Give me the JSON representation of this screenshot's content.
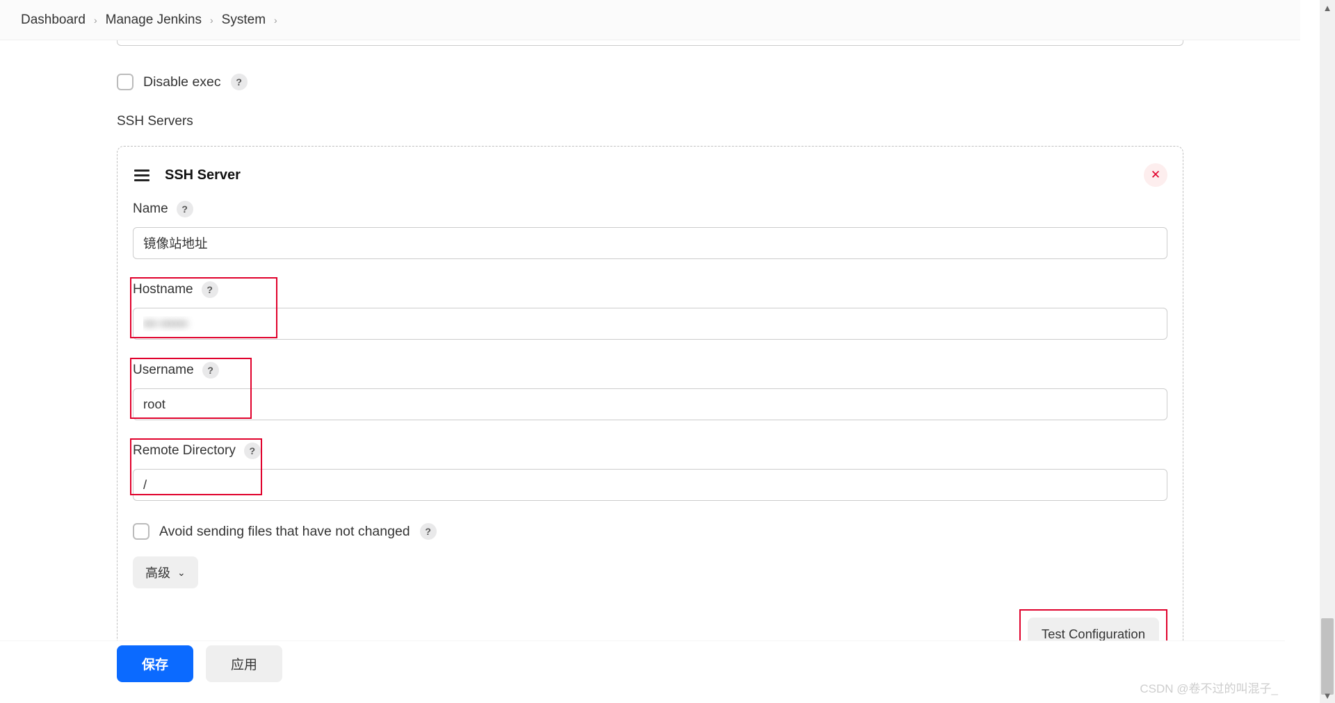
{
  "breadcrumb": {
    "dashboard": "Dashboard",
    "manage": "Manage Jenkins",
    "system": "System"
  },
  "disable_exec": {
    "label": "Disable exec"
  },
  "ssh_servers_heading": "SSH Servers",
  "panel": {
    "title": "SSH Server",
    "name": {
      "label": "Name",
      "value": "镜像站地址"
    },
    "hostname": {
      "label": "Hostname",
      "value": "••• ••••••"
    },
    "username": {
      "label": "Username",
      "value": "root"
    },
    "remote_dir": {
      "label": "Remote Directory",
      "value": "/"
    },
    "avoid_unchanged": {
      "label": "Avoid sending files that have not changed"
    },
    "advanced": "高级",
    "test_btn": "Test Configuration"
  },
  "buttons": {
    "save": "保存",
    "apply": "应用"
  },
  "watermark": "CSDN @卷不过的叫混子_"
}
